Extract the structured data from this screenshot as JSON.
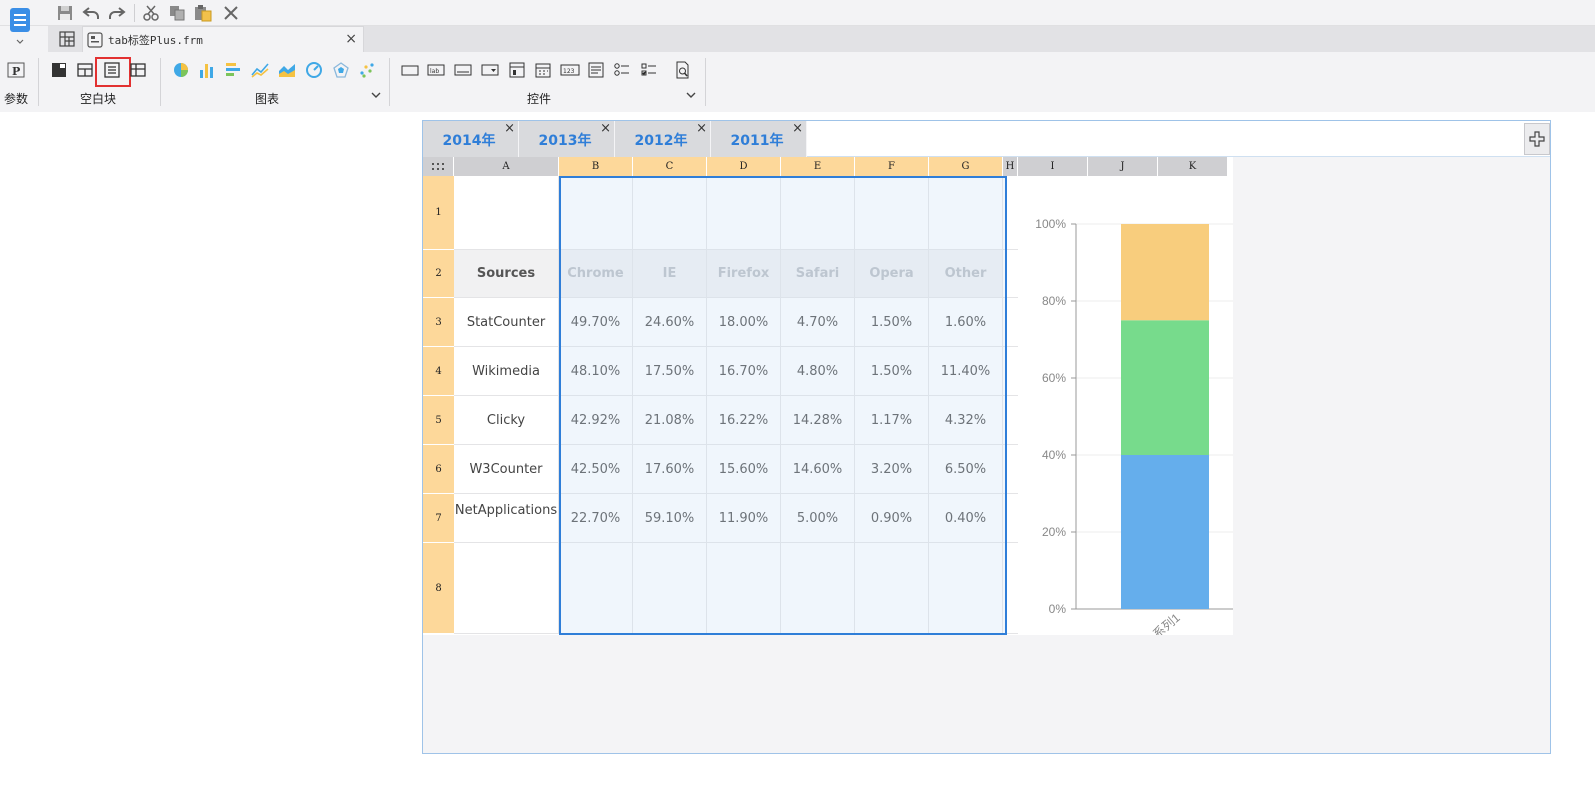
{
  "quick_access": {
    "save_icon": "save-icon",
    "undo_icon": "undo-icon",
    "redo_icon": "redo-icon",
    "cut_icon": "cut-icon",
    "copy_icon": "copy-icon",
    "paste_icon": "paste-icon",
    "delete_icon": "delete-icon"
  },
  "file_tab": {
    "name": "tab标签Plus.frm",
    "close": "×"
  },
  "ribbon": {
    "param_label": "参数",
    "blank_block_label": "空白块",
    "chart_label": "图表",
    "controls_label": "控件"
  },
  "year_tabs": [
    {
      "label": "2014年",
      "close": "×"
    },
    {
      "label": "2013年",
      "close": "×"
    },
    {
      "label": "2012年",
      "close": "×"
    },
    {
      "label": "2011年",
      "close": "×"
    }
  ],
  "grid": {
    "columns": [
      "A",
      "B",
      "C",
      "D",
      "E",
      "F",
      "G",
      "H",
      "I",
      "J",
      "K"
    ],
    "rows": [
      "1",
      "2",
      "3",
      "4",
      "5",
      "6",
      "7",
      "8"
    ],
    "header_row": [
      "Sources",
      "Chrome",
      "IE",
      "Firefox",
      "Safari",
      "Opera",
      "Other"
    ],
    "data_rows": [
      [
        "StatCounter",
        "49.70%",
        "24.60%",
        "18.00%",
        "4.70%",
        "1.50%",
        "1.60%"
      ],
      [
        "Wikimedia",
        "48.10%",
        "17.50%",
        "16.70%",
        "4.80%",
        "1.50%",
        "11.40%"
      ],
      [
        "Clicky",
        "42.92%",
        "21.08%",
        "16.22%",
        "14.28%",
        "1.17%",
        "4.32%"
      ],
      [
        "W3Counter",
        "42.50%",
        "17.60%",
        "15.60%",
        "14.60%",
        "3.20%",
        "6.50%"
      ],
      [
        "NetApplications",
        "22.70%",
        "59.10%",
        "11.90%",
        "5.00%",
        "0.90%",
        "0.40%"
      ]
    ]
  },
  "colors": {
    "accent": "#2f7ed8",
    "row_header": "#fdd89a",
    "selected_col_header": "#fdd89a",
    "col_header": "#cfcfd2"
  },
  "chart_data": {
    "type": "bar",
    "stacked": true,
    "percent": true,
    "categories": [
      "系列1"
    ],
    "series": [
      {
        "values": [
          40
        ],
        "color": "#65aeec"
      },
      {
        "values": [
          35
        ],
        "color": "#77db8c"
      },
      {
        "values": [
          25
        ],
        "color": "#f8cd7d"
      }
    ],
    "yticks": [
      "0%",
      "20%",
      "40%",
      "60%",
      "80%",
      "100%"
    ],
    "ylim": [
      0,
      100
    ],
    "grid": true
  }
}
